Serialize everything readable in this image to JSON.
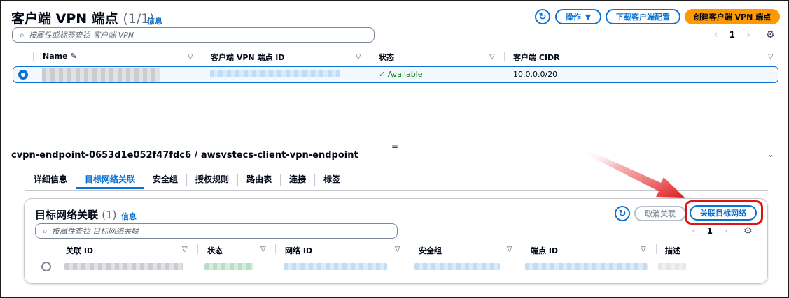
{
  "top": {
    "title": "客户端 VPN 端点",
    "count": "(1/1)",
    "info": "信息",
    "actions_label": "操作",
    "download_config_label": "下载客户端配置",
    "create_label": "创建客户端 VPN 端点",
    "search_placeholder": "按属性或标签查找 客户端 VPN",
    "page": "1",
    "columns": [
      "Name",
      "客户端 VPN 端点 ID",
      "状态",
      "客户端 CIDR"
    ],
    "row": {
      "status": "Available",
      "cidr": "10.0.0.0/20"
    }
  },
  "detail": {
    "title": "cvpn-endpoint-0653d1e052f47fdc6 / awsvstecs-client-vpn-endpoint",
    "tabs": [
      "详细信息",
      "目标网络关联",
      "安全组",
      "授权规则",
      "路由表",
      "连接",
      "标签"
    ],
    "active_tab": 1
  },
  "card": {
    "title": "目标网络关联",
    "count": "(1)",
    "info": "信息",
    "disassociate_label": "取消关联",
    "associate_label": "关联目标网络",
    "search_placeholder": "按属性查找 目标网络关联",
    "page": "1",
    "columns": [
      "关联 ID",
      "状态",
      "网络 ID",
      "安全组",
      "端点 ID",
      "描述"
    ]
  },
  "colors": {
    "accent": "#0972d3",
    "primary": "#ff9900",
    "success": "#037f0c",
    "callout": "#d91515"
  },
  "icons": [
    "refresh-icon",
    "caret-down-icon",
    "search-icon",
    "chevron-left-icon",
    "chevron-right-icon",
    "gear-icon",
    "edit-icon",
    "check-circle-icon",
    "collapse-icon"
  ]
}
